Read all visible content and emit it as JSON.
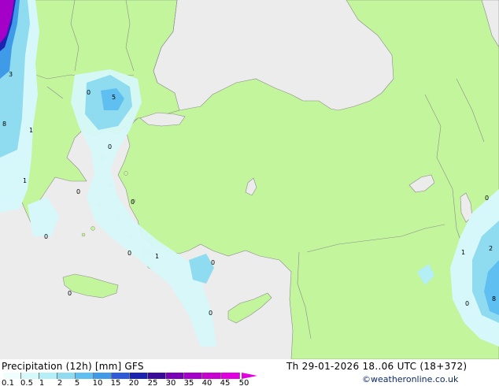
{
  "title": "Precipitation (12h) [mm] GFS",
  "run_info": "Th 29-01-2026 18..06 UTC (18+372)",
  "copyright": "©weatheronline.co.uk",
  "colors": {
    "sea": "#ececec",
    "land": "#c2f59c",
    "border": "#8c8c8c",
    "legend_text": "#000000",
    "copyright_text": "#0a2a6a"
  },
  "legend": {
    "ticks": [
      "0.1",
      "0.5",
      "1",
      "2",
      "5",
      "10",
      "15",
      "20",
      "25",
      "30",
      "35",
      "40",
      "45",
      "50"
    ],
    "swatch_colors": [
      "#f0fdfd",
      "#d6f8fa",
      "#b4eef6",
      "#8fdbf0",
      "#5fbff0",
      "#3f9ae8",
      "#2f5ad8",
      "#1a24b0",
      "#3a0a98",
      "#7a00b8",
      "#a400c8",
      "#c800d0",
      "#e000e0"
    ]
  },
  "map_labels": [
    {
      "text": "3",
      "area": "west-coast-top"
    },
    {
      "text": "8",
      "area": "west-coast-mid"
    },
    {
      "text": "1",
      "area": "west-coast-lower"
    },
    {
      "text": "1",
      "area": "albania-coast"
    },
    {
      "text": "0",
      "area": "macedonia"
    },
    {
      "text": "5",
      "area": "thrace"
    },
    {
      "text": "0",
      "area": "north-aegean"
    },
    {
      "text": "0",
      "area": "central-greece"
    },
    {
      "text": "0",
      "area": "aegean-center"
    },
    {
      "text": "0",
      "area": "peloponnese"
    },
    {
      "text": "0",
      "area": "south-aegean"
    },
    {
      "text": "1",
      "area": "dodecanese"
    },
    {
      "text": "0",
      "area": "antalya-gulf"
    },
    {
      "text": "0",
      "area": "crete"
    },
    {
      "text": "0",
      "area": "east-mediterranean"
    },
    {
      "text": "0",
      "area": "caucasus"
    },
    {
      "text": "1",
      "area": "iran-west"
    },
    {
      "text": "2",
      "area": "iran-north"
    },
    {
      "text": "8",
      "area": "iran-south"
    },
    {
      "text": "0",
      "area": "iraq-north"
    }
  ]
}
